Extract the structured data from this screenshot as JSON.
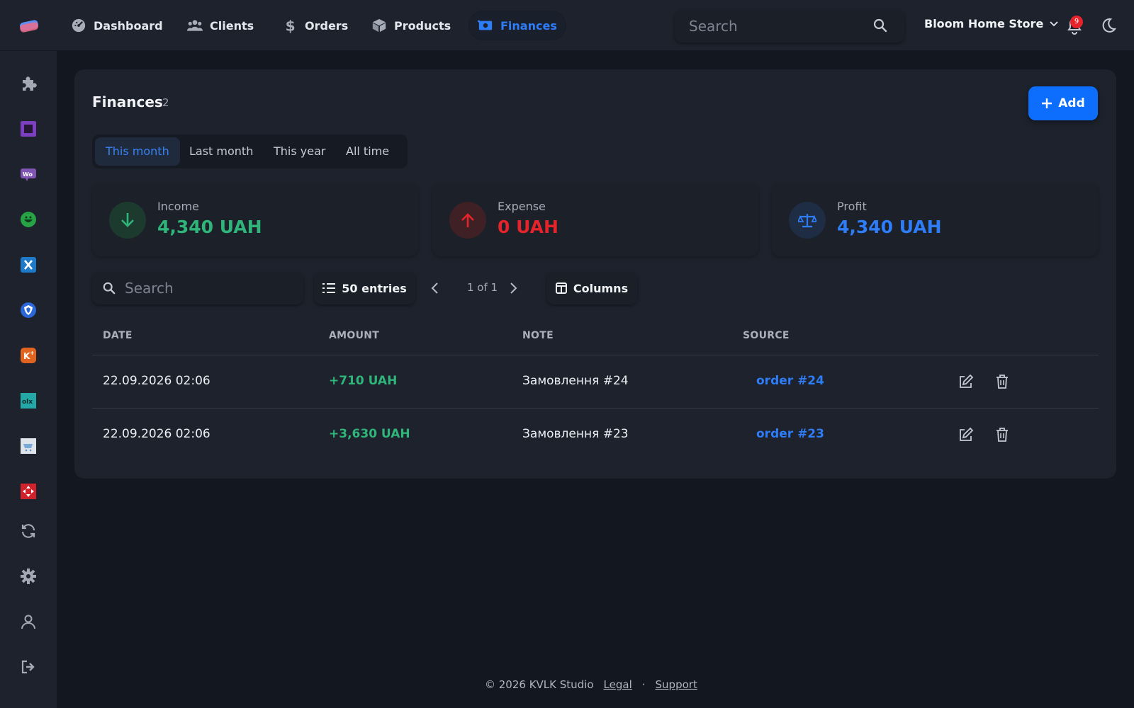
{
  "nav": {
    "items": [
      {
        "label": "Dashboard",
        "icon": "gauge-icon"
      },
      {
        "label": "Clients",
        "icon": "users-icon"
      },
      {
        "label": "Orders",
        "icon": "dollar-icon"
      },
      {
        "label": "Products",
        "icon": "box-icon"
      },
      {
        "label": "Finances",
        "icon": "money-icon",
        "active": true
      }
    ],
    "search_placeholder": "Search",
    "store_name": "Bloom Home Store",
    "notifications_count": "9"
  },
  "sidebar": {
    "icons": [
      "puzzle-icon",
      "square-app-icon",
      "woo-icon",
      "green-app-icon",
      "x-app-icon",
      "shield-app-icon",
      "k-app-icon",
      "olx-icon",
      "cart-app-icon",
      "red-app-icon",
      "sync-icon",
      "gear-icon",
      "user-icon",
      "logout-icon"
    ]
  },
  "page": {
    "title": "Finances",
    "count": "2",
    "add_label": "Add",
    "periods": [
      "This month",
      "Last month",
      "This year",
      "All time"
    ],
    "active_period": "This month"
  },
  "stats": [
    {
      "label": "Income",
      "value": "4,340 UAH",
      "color": "#2fb57a"
    },
    {
      "label": "Expense",
      "value": "0 UAH",
      "color": "#e5232a"
    },
    {
      "label": "Profit",
      "value": "4,340 UAH",
      "color": "#2e7cf6"
    }
  ],
  "table_controls": {
    "search_placeholder": "Search",
    "entries_label": "50 entries",
    "pager_text": "1 of 1",
    "columns_label": "Columns"
  },
  "table": {
    "headers": [
      "DATE",
      "AMOUNT",
      "NOTE",
      "SOURCE"
    ],
    "rows": [
      {
        "date": "22.09.2026 02:06",
        "amount": "+710 UAH",
        "note": "Замовлення #24",
        "source": "order #24"
      },
      {
        "date": "22.09.2026 02:06",
        "amount": "+3,630 UAH",
        "note": "Замовлення #23",
        "source": "order #23"
      }
    ]
  },
  "footer": {
    "copyright": "© 2026 KVLK Studio",
    "legal": "Legal",
    "separator": "·",
    "support": "Support"
  }
}
